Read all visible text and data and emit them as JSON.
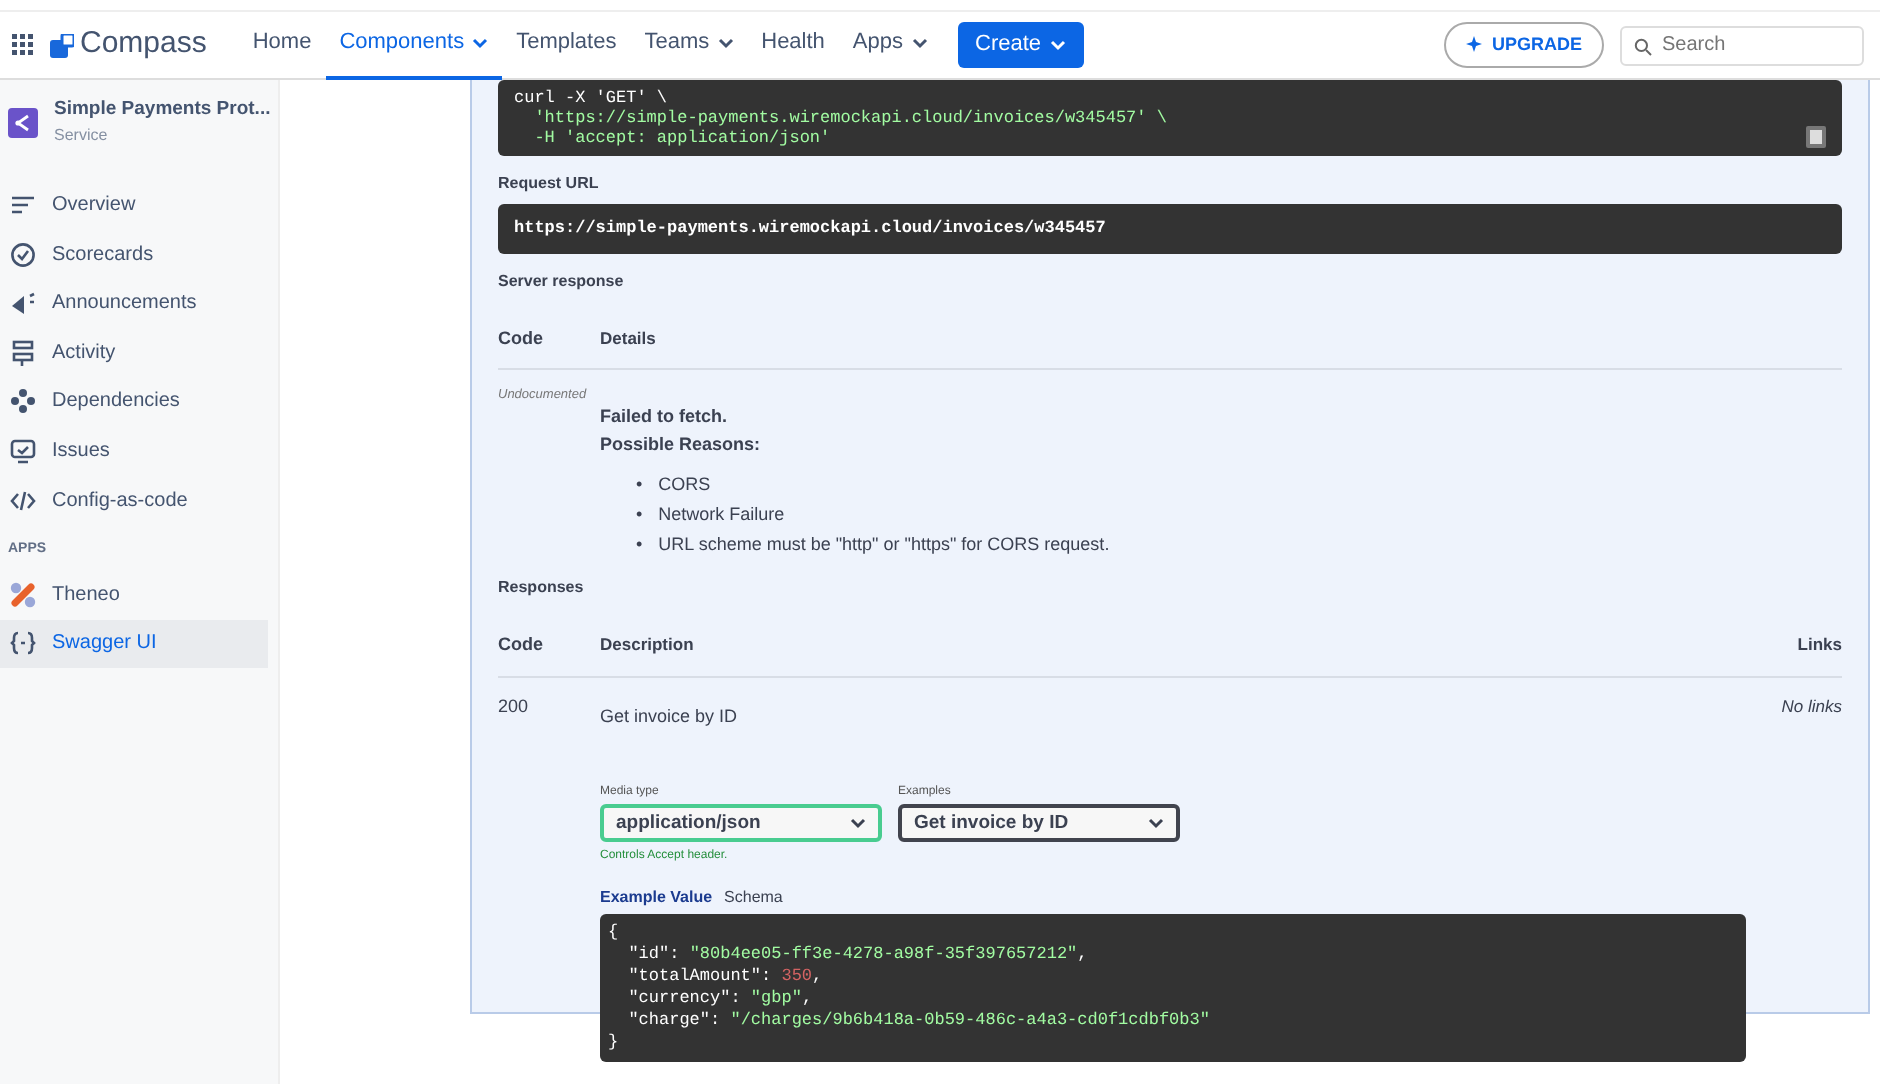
{
  "topbar": {
    "logo": "Compass",
    "nav": [
      {
        "label": "Home",
        "selected": false,
        "dropdown": false
      },
      {
        "label": "Components",
        "selected": true,
        "dropdown": true
      },
      {
        "label": "Templates",
        "selected": false,
        "dropdown": false
      },
      {
        "label": "Teams",
        "selected": false,
        "dropdown": true
      },
      {
        "label": "Health",
        "selected": false,
        "dropdown": false
      },
      {
        "label": "Apps",
        "selected": false,
        "dropdown": true
      }
    ],
    "create_button": "Create",
    "upgrade_button": "UPGRADE",
    "search": {
      "placeholder": "Search"
    }
  },
  "sidebar": {
    "component": {
      "name": "Simple Payments Prot...",
      "type": "Service"
    },
    "items": [
      {
        "label": "Overview",
        "selected": false
      },
      {
        "label": "Scorecards",
        "selected": false
      },
      {
        "label": "Announcements",
        "selected": false
      },
      {
        "label": "Activity",
        "selected": false
      },
      {
        "label": "Dependencies",
        "selected": false
      },
      {
        "label": "Issues",
        "selected": false
      },
      {
        "label": "Config-as-code",
        "selected": false
      }
    ],
    "apps_heading": "APPS",
    "apps": [
      {
        "label": "Theneo",
        "selected": false
      },
      {
        "label": "Swagger UI",
        "selected": true
      }
    ]
  },
  "swagger": {
    "curl_lines": [
      "curl -X 'GET' \\",
      "  'https://simple-payments.wiremockapi.cloud/invoices/w345457' \\",
      "  -H 'accept: application/json'"
    ],
    "request_url_label": "Request URL",
    "request_url": "https://simple-payments.wiremockapi.cloud/invoices/w345457",
    "server_response_label": "Server response",
    "server_columns": [
      "Code",
      "Details"
    ],
    "server_row": {
      "code": "Undocumented",
      "error_title": "Failed to fetch.",
      "reasons_title": "Possible Reasons:",
      "reasons": [
        {
          "bullet": "•",
          "text": "CORS"
        },
        {
          "bullet": "•",
          "text": "Network Failure"
        },
        {
          "bullet": "•",
          "text": "URL scheme must be \"http\" or \"https\" for CORS request."
        }
      ]
    },
    "responses_label": "Responses",
    "response_columns": [
      "Code",
      "Description",
      "Links"
    ],
    "responses": [
      {
        "code": "200",
        "description": "Get invoice by ID",
        "links": "No links",
        "media_type_label": "Media type",
        "media_type": "application/json",
        "media_hint": "Controls Accept header.",
        "examples_label": "Examples",
        "example": "Get invoice by ID",
        "tabs": [
          {
            "label": "Example Value",
            "selected": true
          },
          {
            "label": "Schema",
            "selected": false
          }
        ],
        "example_lines": [
          [
            {
              "kind": "punct",
              "text": "{"
            }
          ],
          [
            {
              "kind": "key",
              "text": "  \"id\""
            },
            {
              "kind": "punct",
              "text": ": "
            },
            {
              "kind": "string",
              "text": "\"80b4ee05-ff3e-4278-a98f-35f397657212\""
            },
            {
              "kind": "punct",
              "text": ","
            }
          ],
          [
            {
              "kind": "key",
              "text": "  \"totalAmount\""
            },
            {
              "kind": "punct",
              "text": ": "
            },
            {
              "kind": "number",
              "text": "350"
            },
            {
              "kind": "punct",
              "text": ","
            }
          ],
          [
            {
              "kind": "key",
              "text": "  \"currency\""
            },
            {
              "kind": "punct",
              "text": ": "
            },
            {
              "kind": "string",
              "text": "\"gbp\""
            },
            {
              "kind": "punct",
              "text": ","
            }
          ],
          [
            {
              "kind": "key",
              "text": "  \"charge\""
            },
            {
              "kind": "punct",
              "text": ": "
            },
            {
              "kind": "string",
              "text": "\"/charges/9b6b418a-0b59-486c-a4a3-cd0f1cdbf0b3\""
            }
          ],
          [
            {
              "kind": "punct",
              "text": "}"
            }
          ]
        ]
      }
    ]
  }
}
